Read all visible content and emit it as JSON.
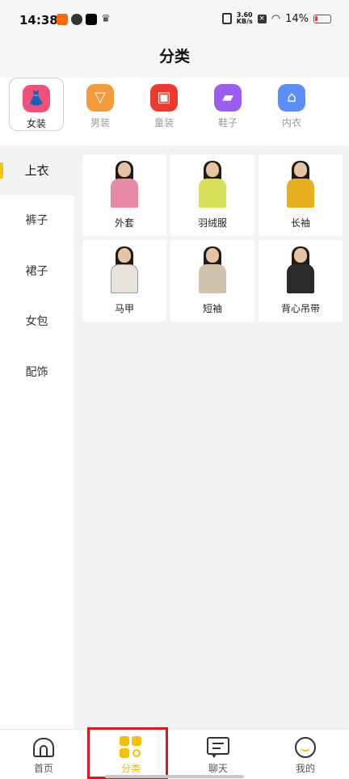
{
  "status_bar": {
    "time": "14:38",
    "net_speed_top": "3.60",
    "net_speed_bottom": "KB/s",
    "battery": "14%",
    "apps": [
      "taobao-icon",
      "cat-icon",
      "tiktok-icon",
      "crown-icon"
    ]
  },
  "header": {
    "title": "分类"
  },
  "top_categories": [
    {
      "label": "女装",
      "icon": "dress-icon",
      "color": "#f0507a",
      "active": true
    },
    {
      "label": "男装",
      "icon": "shirt-icon",
      "color": "#f59a3b",
      "active": false
    },
    {
      "label": "童装",
      "icon": "kids-clothes-icon",
      "color": "#ee3a2e",
      "active": false
    },
    {
      "label": "鞋子",
      "icon": "shoe-icon",
      "color": "#9b5cf0",
      "active": false
    },
    {
      "label": "内衣",
      "icon": "underwear-icon",
      "color": "#5b8ff5",
      "active": false
    }
  ],
  "sidebar": {
    "items": [
      {
        "label": "上衣",
        "active": true
      },
      {
        "label": "裤子",
        "active": false
      },
      {
        "label": "裙子",
        "active": false
      },
      {
        "label": "女包",
        "active": false
      },
      {
        "label": "配饰",
        "active": false
      }
    ]
  },
  "subcategories": [
    {
      "label": "外套",
      "color": "#e88aa6"
    },
    {
      "label": "羽绒服",
      "color": "#d8e05a"
    },
    {
      "label": "长袖",
      "color": "#e8b020"
    },
    {
      "label": "马甲",
      "color": "#e8e4dc"
    },
    {
      "label": "短袖",
      "color": "#cfc3ad"
    },
    {
      "label": "背心吊带",
      "color": "#2a2a2a"
    }
  ],
  "bottom_nav": [
    {
      "label": "首页",
      "icon": "home-icon",
      "active": false
    },
    {
      "label": "分类",
      "icon": "category-search-icon",
      "active": true
    },
    {
      "label": "聊天",
      "icon": "chat-icon",
      "active": false
    },
    {
      "label": "我的",
      "icon": "profile-icon",
      "active": false
    }
  ],
  "colors": {
    "accent": "#f5b800",
    "highlight": "#e0161e"
  }
}
